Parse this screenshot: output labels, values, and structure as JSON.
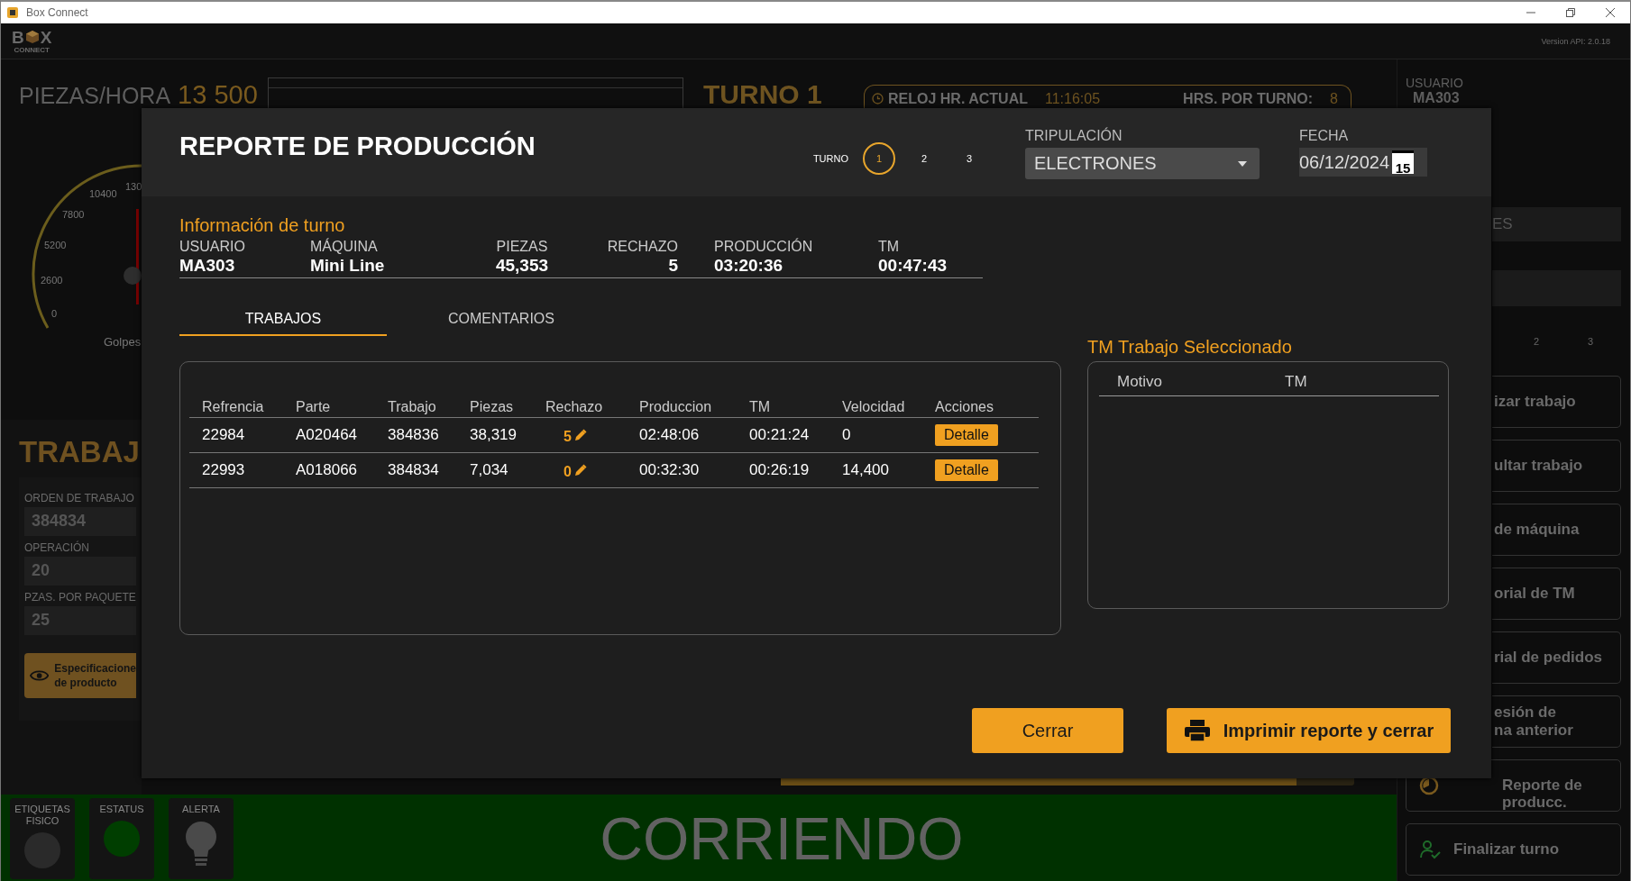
{
  "window": {
    "title": "Box Connect"
  },
  "header": {
    "logo_left": "B",
    "logo_right": "X",
    "logo_sub": "CONNECT",
    "api_version": "Version API: 2.0.18"
  },
  "top": {
    "rate_label": "PIEZAS/HORA",
    "rate_value": "13 500",
    "shift_title": "TURNO 1",
    "clock_label": "RELOJ HR. ACTUAL",
    "clock_time": "11:16:05",
    "hours_label": "HRS. POR TURNO:",
    "hours_value": "8"
  },
  "gauge": {
    "ticks": [
      "130",
      "10400",
      "7800",
      "5200",
      "2600",
      "0"
    ],
    "caption": "Golpes"
  },
  "job_panel": {
    "title": "TRABAJ",
    "fields": [
      {
        "label": "ORDEN DE TRABAJO",
        "value": "384834"
      },
      {
        "label": "OPERACIÓN",
        "value": "20"
      },
      {
        "label": "PZAS. POR PAQUETE",
        "value": "25"
      }
    ],
    "spec_button": "Especificacione\nde producto"
  },
  "status_tiles": [
    {
      "label": "ETIQUETAS\nFISICO",
      "kind": "lamp",
      "on": false
    },
    {
      "label": "ESTATUS",
      "kind": "lamp",
      "on": true
    },
    {
      "label": "ALERTA",
      "kind": "bulb",
      "on": false
    }
  ],
  "progress": {
    "level": 0.9
  },
  "status_text": "CORRIENDO",
  "sidebar": {
    "user_label": "USUARIO",
    "user": "MA303",
    "crew_value": "ES",
    "turns": [
      {
        "label": "2",
        "selected": false
      },
      {
        "label": "3",
        "selected": false
      }
    ],
    "actions": [
      {
        "label": "izar trabajo",
        "kind": "covered"
      },
      {
        "label": "ultar trabajo",
        "kind": "covered"
      },
      {
        "label": "de máquina",
        "kind": "covered"
      },
      {
        "label": "orial de TM",
        "kind": "covered"
      },
      {
        "label": "rial de pedidos",
        "kind": "covered"
      },
      {
        "label": "esión de\nna anterior",
        "kind": "covered"
      },
      {
        "label": "Reporte de\nproducc.",
        "kind": "report"
      },
      {
        "label": "Finalizar turno",
        "kind": "finish"
      }
    ]
  },
  "report": {
    "title": "REPORTE DE PRODUCCIÓN",
    "shift_label": "TURNO",
    "shifts": [
      {
        "label": "1",
        "selected": true
      },
      {
        "label": "2",
        "selected": false
      },
      {
        "label": "3",
        "selected": false
      }
    ],
    "crew": {
      "label": "TRIPULACIÓN",
      "value": "ELECTRONES"
    },
    "date": {
      "label": "FECHA",
      "value": "06/12/2024",
      "icon_day": "15"
    },
    "info_title": "Información de turno",
    "info": [
      {
        "label": "USUARIO",
        "value": "MA303"
      },
      {
        "label": "MÁQUINA",
        "value": "Mini Line"
      },
      {
        "label": "PIEZAS",
        "value": "45,353"
      },
      {
        "label": "RECHAZO",
        "value": "5"
      },
      {
        "label": "PRODUCCIÓN",
        "value": "03:20:36"
      },
      {
        "label": "TM",
        "value": "00:47:43"
      }
    ],
    "tabs": [
      {
        "label": "TRABAJOS",
        "selected": true
      },
      {
        "label": "COMENTARIOS",
        "selected": false
      }
    ],
    "jobs": {
      "columns": [
        "Refrencia",
        "Parte",
        "Trabajo",
        "Piezas",
        "Rechazo",
        "Produccion",
        "TM",
        "Velocidad",
        "Acciones"
      ],
      "rows": [
        {
          "reference": "22984",
          "part": "A020464",
          "job": "384836",
          "pieces": "38,319",
          "reject": "5",
          "production": "02:48:06",
          "tm": "00:21:24",
          "speed": "0",
          "action": "Detalle"
        },
        {
          "reference": "22993",
          "part": "A018066",
          "job": "384834",
          "pieces": "7,034",
          "reject": "0",
          "production": "00:32:30",
          "tm": "00:26:19",
          "speed": "14,400",
          "action": "Detalle"
        }
      ]
    },
    "tm_panel": {
      "title": "TM Trabajo Seleccionado",
      "columns": [
        "Motivo",
        "TM"
      ]
    },
    "buttons": [
      {
        "label": "Cerrar",
        "kind": "plain"
      },
      {
        "label": "Imprimir reporte y cerrar",
        "kind": "print"
      }
    ]
  }
}
